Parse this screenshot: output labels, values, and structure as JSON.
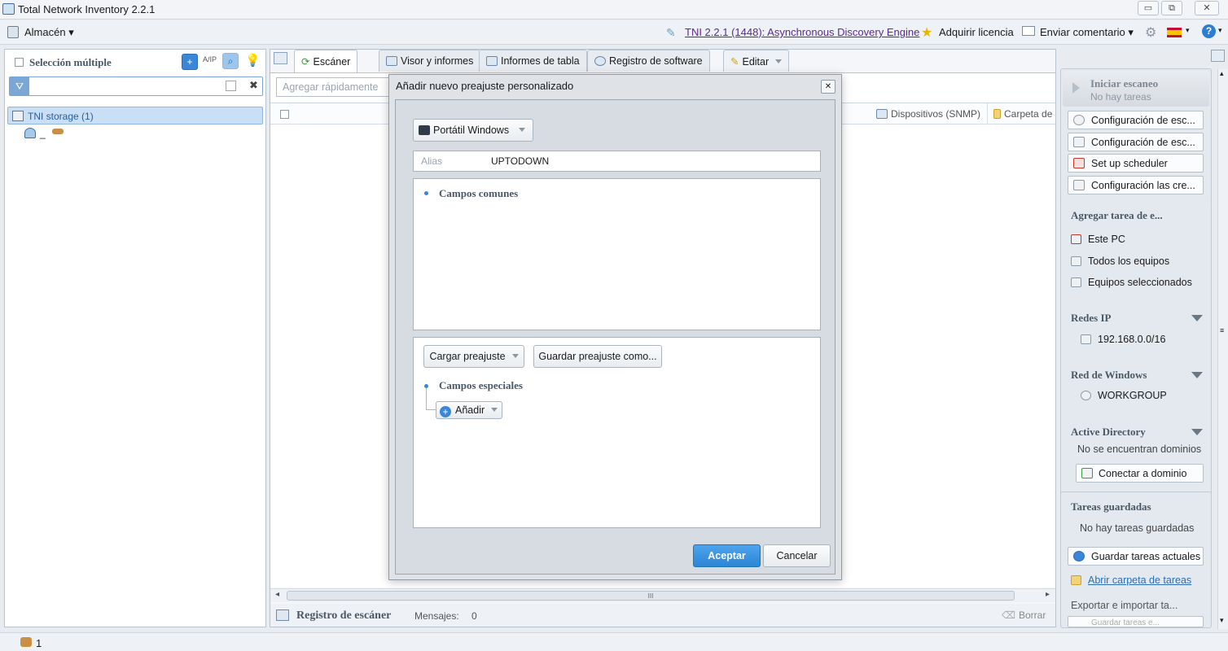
{
  "window": {
    "title": "Total Network Inventory 2.2.1",
    "controls": [
      "▭",
      "⧉",
      "✕"
    ]
  },
  "menubar": {
    "storage_label": "Almacén",
    "update_link": "TNI 2.2.1 (1448): Asynchronous Discovery Engine",
    "buy_license": "Adquirir licencia",
    "send_feedback": "Enviar comentario",
    "help": "?"
  },
  "left": {
    "multi_select_label": "Selección múltiple",
    "ip_toggle": "A/IP",
    "tree_root": "TNI storage (1)",
    "tree_child": "_"
  },
  "main": {
    "tabs": [
      "Escáner",
      "Visor y informes",
      "Informes de tabla",
      "Registro de software",
      "Editar"
    ],
    "quick_add_placeholder": "Agregar rápidamente",
    "col_devices_snmp": "Dispositivos (SNMP)",
    "col_folder": "Carpeta de",
    "scroll_grip": "III",
    "log_title": "Registro de escáner",
    "messages_label": "Mensajes:",
    "messages_count": "0",
    "clear": "Borrar"
  },
  "dialog": {
    "title": "Añadir nuevo preajuste personalizado",
    "close": "✕",
    "device_type": "Portátil Windows",
    "alias_label": "Alias",
    "alias_value": "UPTODOWN",
    "common_fields": "Campos comunes",
    "load_preset": "Cargar preajuste",
    "save_preset_as": "Guardar preajuste como...",
    "special_fields": "Campos especiales",
    "add": "Añadir",
    "ok": "Aceptar",
    "cancel": "Cancelar"
  },
  "right": {
    "start_scan_title": "Iniciar escaneo",
    "start_scan_sub": "No hay tareas",
    "config_buttons": [
      "Configuración de esc...",
      "Configuración de esc...",
      "Set up scheduler",
      "Configuración las cre..."
    ],
    "add_task_head": "Agregar tarea de e...",
    "add_task_items": [
      "Este PC",
      "Todos los equipos",
      "Equipos seleccionados"
    ],
    "ip_networks_head": "Redes IP",
    "ip_network": "192.168.0.0/16",
    "windows_net_head": "Red de Windows",
    "workgroup": "WORKGROUP",
    "ad_head": "Active Directory",
    "no_domains": "No se encuentran dominios",
    "connect_domain": "Conectar a dominio",
    "saved_tasks_head": "Tareas guardadas",
    "no_saved_tasks": "No hay tareas guardadas",
    "save_current_tasks": "Guardar tareas actuales",
    "open_tasks_folder": "Abrir carpeta de tareas",
    "export_import": "Exportar e importar ta...",
    "save_tasks_cut": "Guardar tareas e..."
  },
  "statusbar": {
    "count": "1"
  },
  "colors": {
    "accent": "#2b86d6",
    "link": "#5b2a86",
    "selection": "#c9dff5"
  }
}
